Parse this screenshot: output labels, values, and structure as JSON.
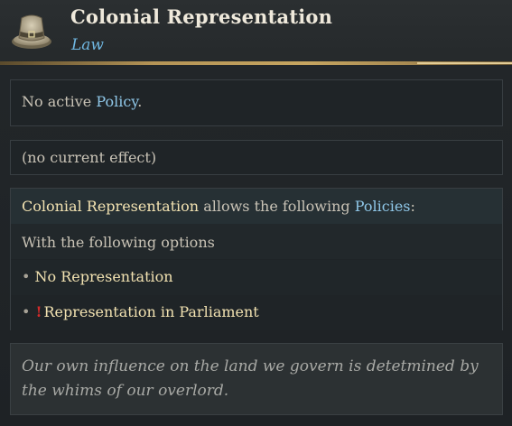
{
  "header": {
    "title": "Colonial Representation",
    "subtitle": "Law",
    "icon": "tricorn-hat-icon"
  },
  "policy_panel": {
    "prefix": "No active ",
    "link": "Policy",
    "suffix": "."
  },
  "effect_panel": {
    "text": "(no current effect)"
  },
  "allows_panel": {
    "law_name": "Colonial Representation",
    "middle": " allows the following ",
    "policies_link": "Policies",
    "colon": ":",
    "options_heading": "With the following options",
    "options": [
      {
        "bullet": "•",
        "label": "No Representation",
        "warning": false
      },
      {
        "bullet": "•",
        "label": "Representation in Parliament",
        "warning": true,
        "warning_glyph": "!"
      }
    ]
  },
  "flavor": {
    "text": "Our own influence on the land we govern is detetmined by the whims of our overlord."
  },
  "colors": {
    "highlight_blue": "#8fc7e8",
    "highlight_gold": "#f2e2b1",
    "accent_gold": "#c6a560",
    "warning_red": "#d22a2a"
  }
}
